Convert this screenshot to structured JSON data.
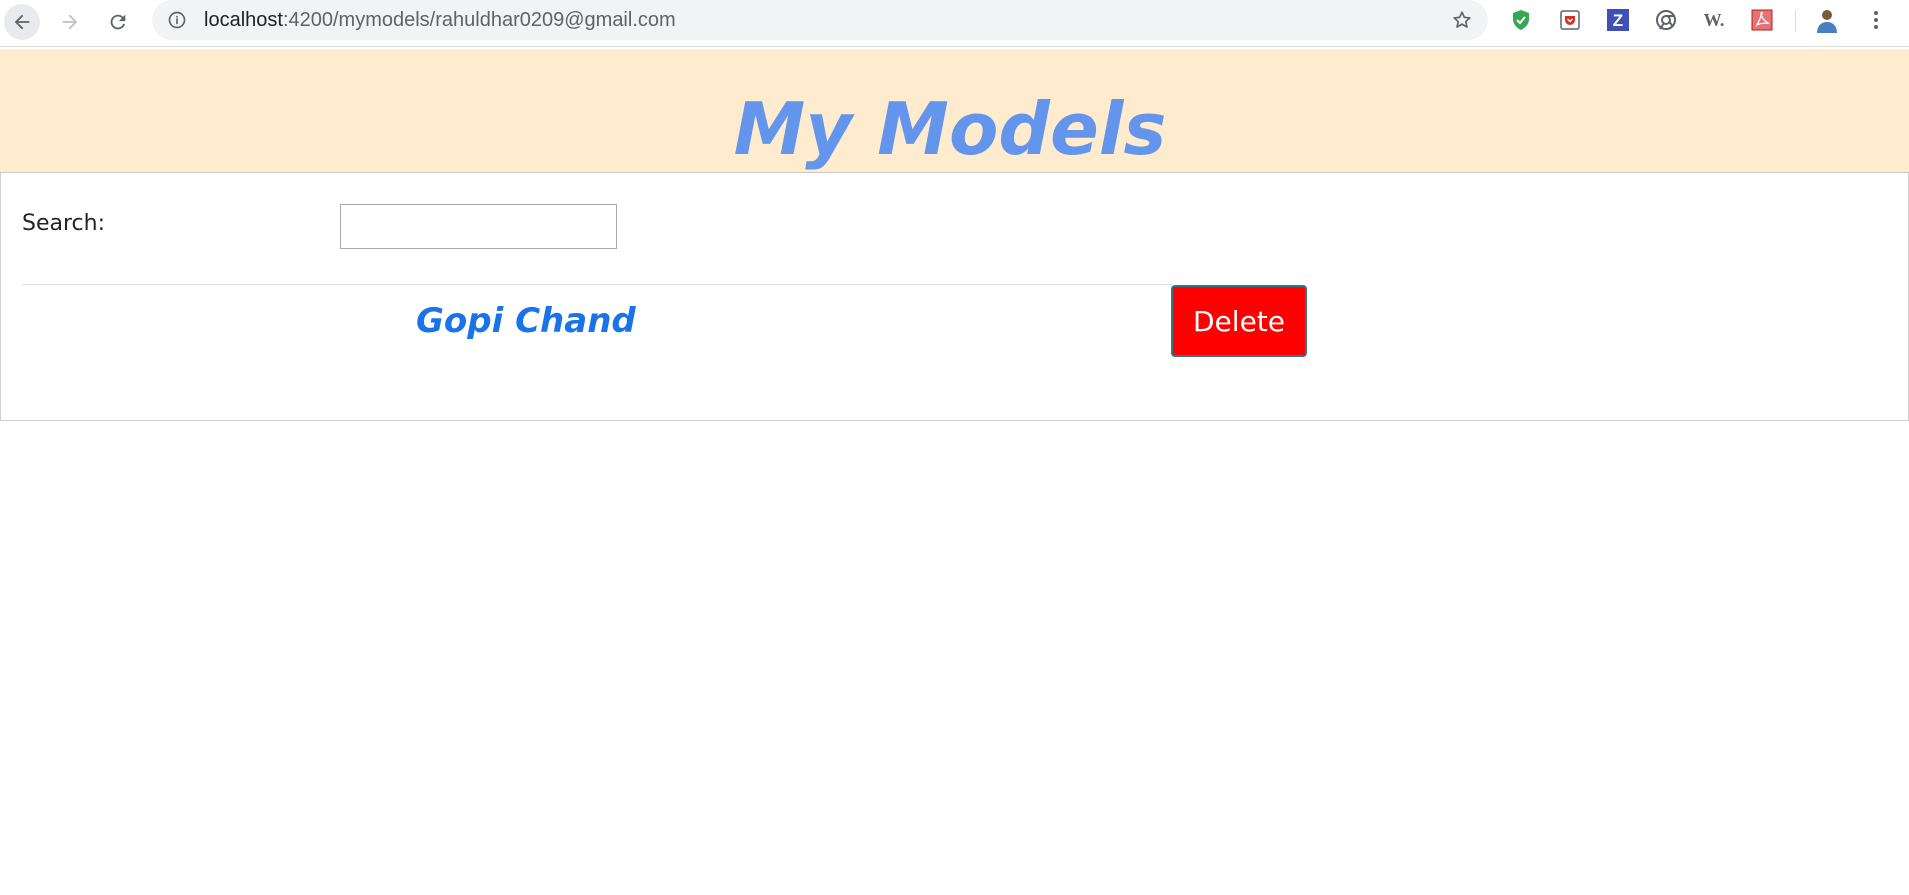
{
  "browser": {
    "url_host": "localhost",
    "url_path": ":4200/mymodels/rahuldhar0209@gmail.com",
    "extensions": [
      "shield-extension",
      "pocket-extension",
      "zotero-extension",
      "chrome-extension",
      "wikiwand-extension",
      "pdf-extension"
    ],
    "zotero_letter": "Z",
    "wikiwand_letter": "W."
  },
  "header": {
    "title": "My Models",
    "background": "#ffebcd",
    "title_color": "#6495ed"
  },
  "search": {
    "label": "Search:",
    "value": "",
    "placeholder": ""
  },
  "models": [
    {
      "name": "Gopi Chand",
      "delete_label": "Delete"
    }
  ],
  "colors": {
    "delete_bg": "#ff0000",
    "model_name": "#1a73e8"
  }
}
